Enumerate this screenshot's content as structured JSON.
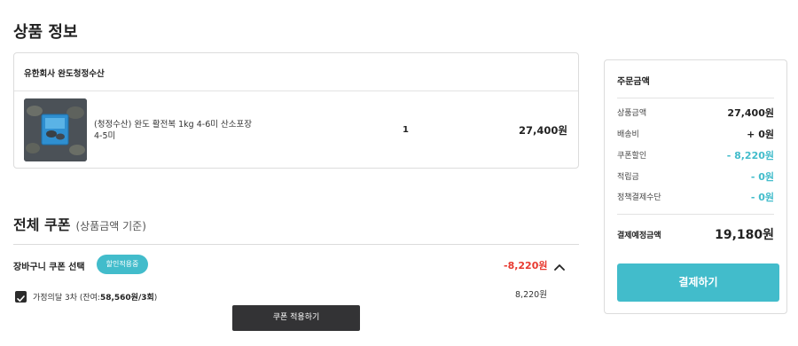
{
  "page_title": "상품 정보",
  "product": {
    "seller": "유한회사 완도청정수산",
    "name": "(청정수산) 완도 활전복 1kg 4-6미 산소포장 4-5미",
    "quantity": "1",
    "price": "27,400원"
  },
  "coupon": {
    "title": "전체 쿠폰",
    "subtitle": "(상품금액 기준)",
    "cart_coupon_label": "장바구니 쿠폰 선택",
    "badge": "할인적용중",
    "discount": "-8,220원",
    "item_prefix": "가정의달 3차 (잔여:",
    "item_remaining": "58,560원/3회",
    "item_suffix": ")",
    "item_amount": "8,220원",
    "apply_button": "쿠폰 적용하기"
  },
  "summary": {
    "title": "주문금액",
    "rows": [
      {
        "label": "상품금액",
        "value": "27,400원"
      },
      {
        "label": "배송비",
        "value": "+ 0원"
      },
      {
        "label": "쿠폰할인",
        "value": "- 8,220원"
      },
      {
        "label": "적립금",
        "value": "- 0원"
      },
      {
        "label": "정책결제수단",
        "value": "- 0원"
      }
    ],
    "total_label": "결제예정금액",
    "total_value": "19,180원",
    "pay_button": "결제하기"
  },
  "colors": {
    "accent": "#42bccb",
    "discount_red": "#e8392f",
    "dark_button": "#333335"
  }
}
